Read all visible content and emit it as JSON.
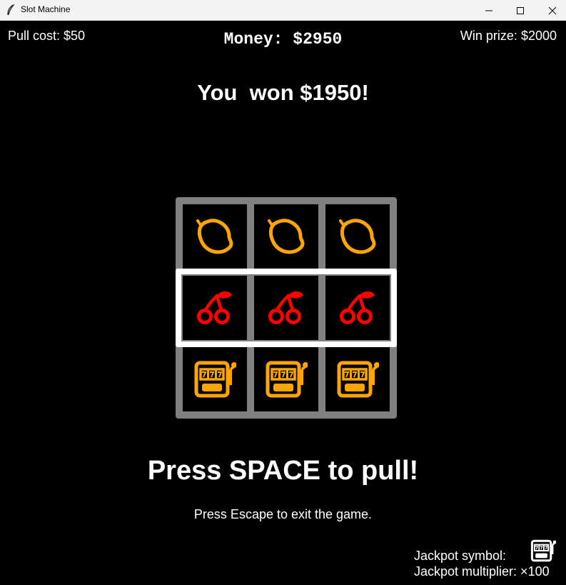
{
  "window": {
    "title": "Slot Machine"
  },
  "hud": {
    "pull_cost": "Pull cost: $50",
    "money": "Money: $2950",
    "win_prize": "Win prize: $2000"
  },
  "result_text": "You  won $1950!",
  "reels": [
    [
      "lemon",
      "lemon",
      "lemon"
    ],
    [
      "cherry",
      "cherry",
      "cherry"
    ],
    [
      "slot-machine",
      "slot-machine",
      "slot-machine"
    ]
  ],
  "winning_row": 2,
  "instructions": {
    "pull": "Press SPACE to pull!",
    "exit": "Press Escape to exit the game."
  },
  "jackpot": {
    "symbol_label": "Jackpot symbol:",
    "symbol_icon": "slot-machine",
    "multiplier": "Jackpot multiplier: ×100"
  },
  "colors": {
    "background": "#000000",
    "text": "#ffffff",
    "grid_frame": "#808080",
    "win_highlight": "#ffffff",
    "lemon": "#ffa500",
    "cherry": "#ff0000",
    "slot_machine": "#ffa500"
  }
}
